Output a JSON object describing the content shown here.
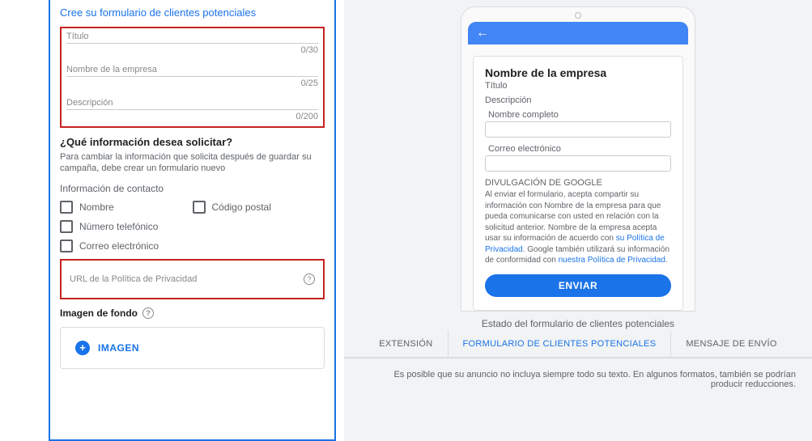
{
  "form": {
    "section_title": "Cree su formulario de clientes potenciales",
    "title_label": "Título",
    "title_counter": "0/30",
    "company_label": "Nombre de la empresa",
    "company_counter": "0/25",
    "description_label": "Descripción",
    "description_counter": "0/200",
    "info_question": "¿Qué información desea solicitar?",
    "info_help": "Para cambiar la información que solicita después de guardar su campaña, debe crear un formulario nuevo",
    "contact_info_label": "Información de contacto",
    "checks": {
      "name": "Nombre",
      "postal": "Código postal",
      "phone": "Número telefónico",
      "email": "Correo electrónico"
    },
    "privacy_url_label": "URL de la Política de Privacidad",
    "bg_label": "Imagen de fondo",
    "image_button": "IMAGEN"
  },
  "preview": {
    "company": "Nombre de la empresa",
    "title": "Título",
    "description": "Descripción",
    "fullname": "Nombre completo",
    "email": "Correo electrónico",
    "disclosure_title": "DIVULGACIÓN DE GOOGLE",
    "disclosure_text1": "Al enviar el formulario, acepta compartir su información con Nombre de la empresa para que pueda comunicarse con usted en relación con la solicitud anterior. Nombre de la empresa acepta usar su información de acuerdo con ",
    "disclosure_link1": "su Política de Privacidad",
    "disclosure_text2": ". Google también utilizará su información de conformidad con ",
    "disclosure_link2": "nuestra Política de Privacidad",
    "send": "ENVIAR",
    "state_label": "Estado del formulario de clientes potenciales",
    "tabs": {
      "ext": "EXTENSIÓN",
      "form": "FORMULARIO DE CLIENTES POTENCIALES",
      "msg": "MENSAJE DE ENVÍO"
    },
    "footer": "Es posible que su anuncio no incluya siempre todo su texto. En algunos formatos, también se podrían producir reducciones."
  }
}
